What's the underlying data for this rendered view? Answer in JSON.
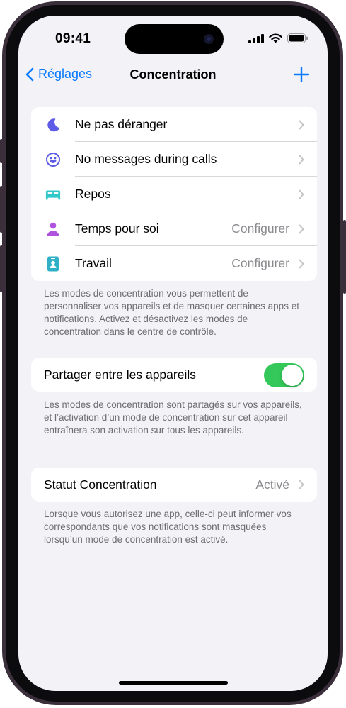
{
  "status_bar": {
    "time": "09:41"
  },
  "nav": {
    "back_label": "Réglages",
    "title": "Concentration"
  },
  "focus_modes": [
    {
      "label": "Ne pas déranger",
      "value": "",
      "icon": "moon-icon",
      "color": "#5e5ce6"
    },
    {
      "label": "No messages during calls",
      "value": "",
      "icon": "smiley-icon",
      "color": "#5e5ce6"
    },
    {
      "label": "Repos",
      "value": "",
      "icon": "bed-icon",
      "color": "#30c8c8"
    },
    {
      "label": "Temps pour soi",
      "value": "Configurer",
      "icon": "person-icon",
      "color": "#af52de"
    },
    {
      "label": "Travail",
      "value": "Configurer",
      "icon": "badge-icon",
      "color": "#30b0c7"
    }
  ],
  "focus_note": "Les modes de concentration vous permettent de personnaliser vos appareils et de masquer certaines apps et notifications. Activez et désactivez les modes de concentration dans le centre de contrôle.",
  "share": {
    "label": "Partager entre les appareils",
    "on": true
  },
  "share_note": "Les modes de concentration sont partagés sur vos appareils, et l’activation d’un mode de concentration sur cet appareil entraînera son activation sur tous les appareils.",
  "status": {
    "label": "Statut Concentration",
    "value": "Activé"
  },
  "status_note": "Lorsque vous autorisez une app, celle-ci peut informer vos correspondants que vos notifications sont masquées lorsqu’un mode de concentration est activé.",
  "colors": {
    "accent": "#0a7aff",
    "toggle_on": "#34c759",
    "background": "#f2f2f7"
  }
}
